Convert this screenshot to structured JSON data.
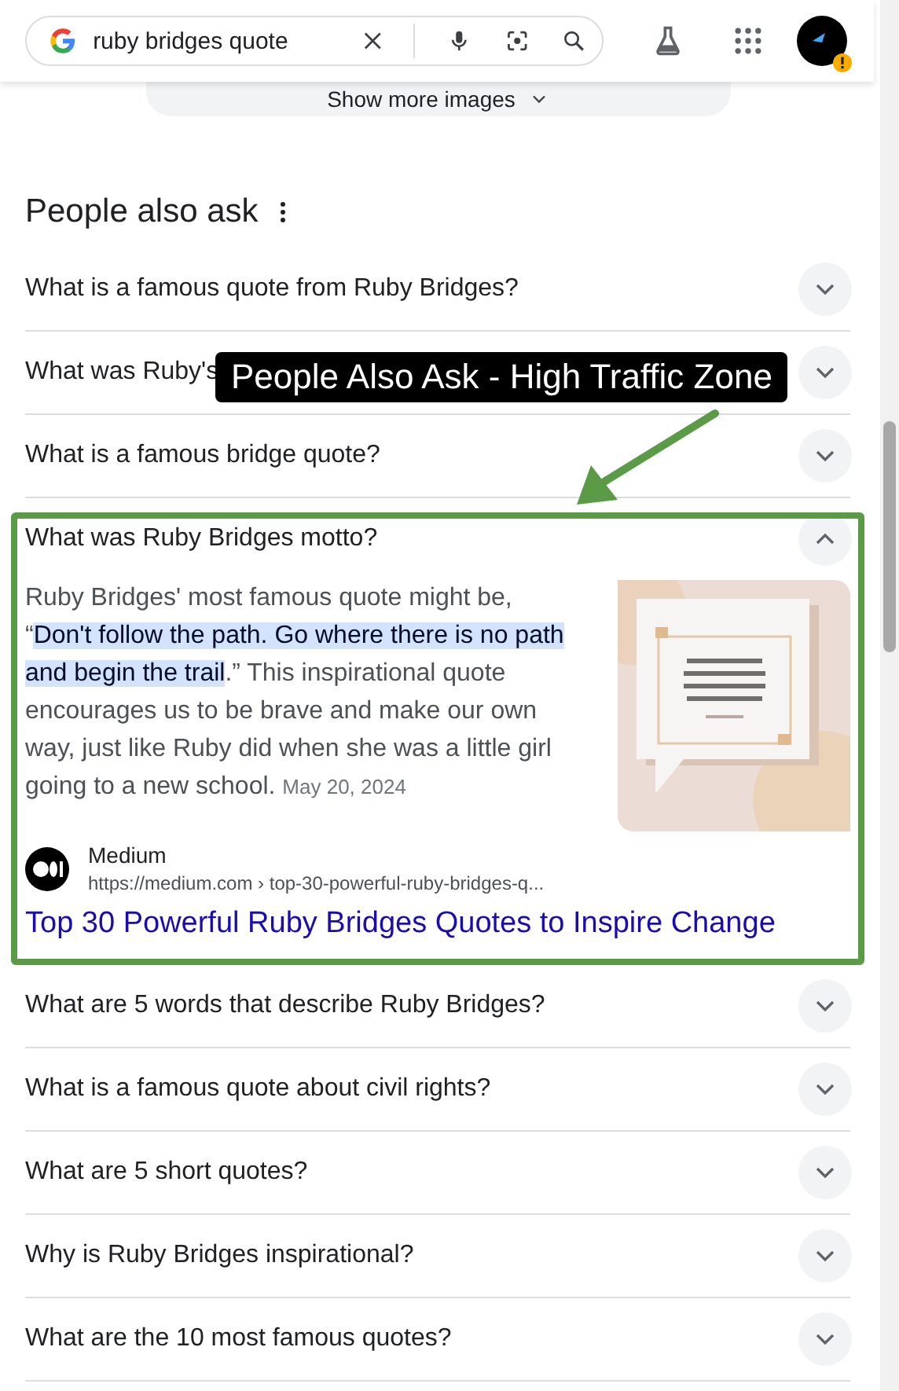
{
  "search": {
    "value": "ruby bridges quote"
  },
  "show_more": {
    "label": "Show more images"
  },
  "section": {
    "title": "People also ask"
  },
  "questions": [
    {
      "text": "What is a famous quote from Ruby Bridges?",
      "expanded": false
    },
    {
      "text": "What was Ruby's",
      "expanded": false
    },
    {
      "text": "What is a famous bridge quote?",
      "expanded": false
    },
    {
      "text": "What was Ruby Bridges motto?",
      "expanded": true,
      "answer": {
        "parts": [
          {
            "text": "Ruby Bridges' most famous quote might be, “",
            "highlighted": false
          },
          {
            "text": "Don't follow the path. ",
            "highlighted": true
          },
          {
            "text": "Go where there is no path and begin the trail",
            "highlighted": true
          },
          {
            "text": ".” This inspirational quote encourages us to be brave and make our own way, just like Ruby did when she was a little girl going to a new school.",
            "highlighted": false
          }
        ],
        "date": "May 20, 2024",
        "source": {
          "name": "Medium",
          "url": "https://medium.com › top-30-powerful-ruby-bridges-q...",
          "title": "Top 30 Powerful Ruby Bridges Quotes to Inspire Change"
        }
      }
    },
    {
      "text": "What are 5 words that describe Ruby Bridges?",
      "expanded": false
    },
    {
      "text": "What is a famous quote about civil rights?",
      "expanded": false
    },
    {
      "text": "What are 5 short quotes?",
      "expanded": false
    },
    {
      "text": "Why is Ruby Bridges inspirational?",
      "expanded": false
    },
    {
      "text": "What are the 10 most famous quotes?",
      "expanded": false
    }
  ],
  "callout": {
    "text": "People Also Ask - High Traffic Zone"
  }
}
